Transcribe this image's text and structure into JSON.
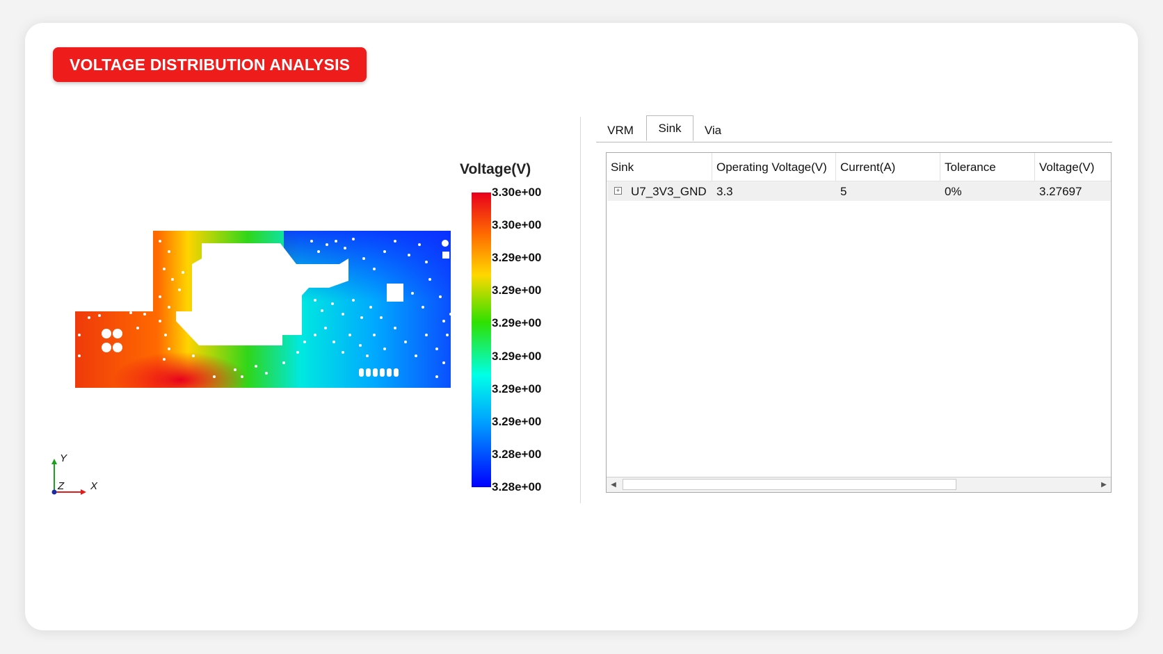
{
  "header": {
    "title": "VOLTAGE DISTRIBUTION ANALYSIS"
  },
  "colorbar": {
    "title": "Voltage(V)",
    "ticks": [
      "3.30e+00",
      "3.30e+00",
      "3.29e+00",
      "3.29e+00",
      "3.29e+00",
      "3.29e+00",
      "3.29e+00",
      "3.29e+00",
      "3.28e+00",
      "3.28e+00"
    ],
    "colors": {
      "high": "#e8001c",
      "mid": "#2fe000",
      "low": "#0000ff"
    }
  },
  "axes": {
    "y": "Y",
    "z": "Z",
    "x": "X",
    "y_color": "#1aa01a",
    "x_color": "#e11a1a",
    "z_color": "#1a2aa8"
  },
  "tabs": [
    {
      "label": "VRM",
      "active": false
    },
    {
      "label": "Sink",
      "active": true
    },
    {
      "label": "Via",
      "active": false
    }
  ],
  "table": {
    "columns": [
      "Sink",
      "Operating Voltage(V)",
      "Current(A)",
      "Tolerance",
      "Voltage(V)"
    ],
    "rows": [
      {
        "expander": "+",
        "sink": "U7_3V3_GND",
        "operating_voltage": "3.3",
        "current": "5",
        "tolerance": "0%",
        "voltage": "3.27697"
      }
    ]
  },
  "scrollbar": {
    "left_arrow": "◀",
    "right_arrow": "▶"
  }
}
